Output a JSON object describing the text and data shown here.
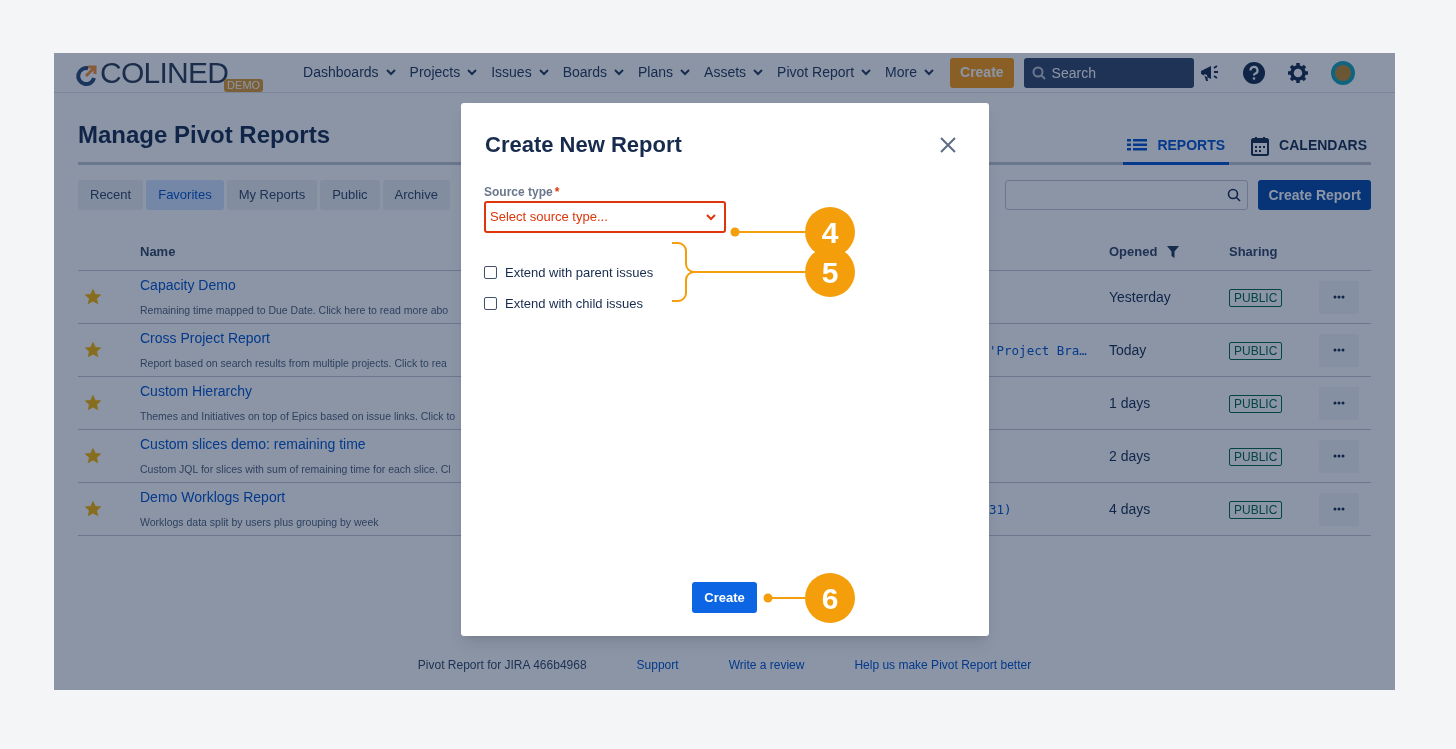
{
  "header": {
    "logo": {
      "text": "COLINED",
      "badge": "DEMO"
    },
    "nav": [
      "Dashboards",
      "Projects",
      "Issues",
      "Boards",
      "Plans",
      "Assets",
      "Pivot Report",
      "More"
    ],
    "create_button": "Create",
    "search": {
      "placeholder": "Search"
    }
  },
  "page": {
    "title": "Manage Pivot Reports",
    "view_tabs": [
      {
        "label": "REPORTS",
        "kind": "list",
        "selected": true
      },
      {
        "label": "CALENDARS",
        "kind": "calendar",
        "selected": false
      }
    ],
    "filter_tabs": [
      {
        "label": "Recent",
        "selected": false
      },
      {
        "label": "Favorites",
        "selected": true
      },
      {
        "label": "My Reports",
        "selected": false
      },
      {
        "label": "Public",
        "selected": false
      },
      {
        "label": "Archive",
        "selected": false
      }
    ],
    "create_report_button": "Create Report"
  },
  "table": {
    "name_header": "Name",
    "opened_header": "Opened",
    "sharing_header": "Sharing",
    "rows": [
      {
        "starred": true,
        "title": "Capacity Demo",
        "description": "Remaining time mapped to Due Date. Click here to read more abo",
        "opened": "Yesterday",
        "sharing": "PUBLIC"
      },
      {
        "starred": true,
        "title": "Cross Project Report",
        "description": "Report based on search results from multiple projects. Click to rea",
        "column_3": "'Project Bra…",
        "opened": "Today",
        "sharing": "PUBLIC"
      },
      {
        "starred": true,
        "title": "Custom Hierarchy",
        "description": "Themes and Initiatives on top of Epics based on issue links. Click to",
        "opened": "1 days",
        "sharing": "PUBLIC"
      },
      {
        "starred": true,
        "title": "Custom slices demo: remaining time",
        "description": "Custom JQL for slices with sum of remaining time for each slice. Cl",
        "opened": "2 days",
        "sharing": "PUBLIC"
      },
      {
        "starred": true,
        "title": "Demo Worklogs Report",
        "description": "Worklogs data split by users plus grouping by week",
        "column_3": "31)",
        "opened": "4 days",
        "sharing": "PUBLIC"
      }
    ]
  },
  "footer": {
    "version": "Pivot Report for JIRA 466b4968",
    "links": [
      "Support",
      "Write a review",
      "Help us make Pivot Report better"
    ]
  },
  "modal": {
    "title": "Create New Report",
    "field": {
      "label": "Source type",
      "required_marker": "*",
      "placeholder": "Select source type...",
      "error": true
    },
    "checkboxes": [
      {
        "label": "Extend with parent issues",
        "checked": false
      },
      {
        "label": "Extend with child issues",
        "checked": false
      }
    ],
    "button": "Create"
  },
  "callouts": [
    {
      "number": "4",
      "kind": "dot"
    },
    {
      "number": "5",
      "kind": "bracket"
    },
    {
      "number": "6",
      "kind": "dot"
    }
  ]
}
